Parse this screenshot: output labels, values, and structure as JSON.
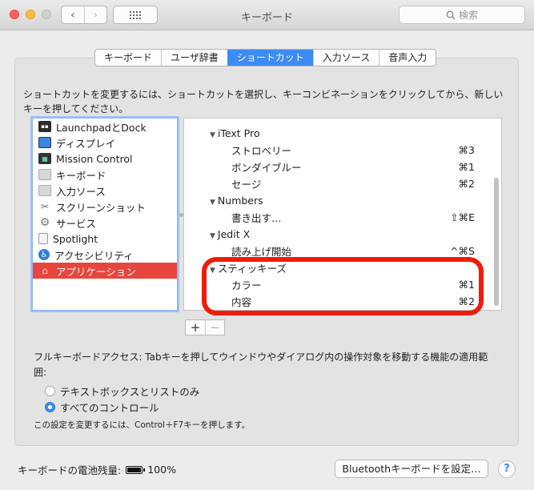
{
  "window": {
    "title": "キーボード",
    "search_placeholder": "検索",
    "back_glyph": "‹",
    "forward_glyph": "›"
  },
  "tabs": [
    {
      "label": "キーボード"
    },
    {
      "label": "ユーザ辞書"
    },
    {
      "label": "ショートカット",
      "active": true
    },
    {
      "label": "入力ソース"
    },
    {
      "label": "音声入力"
    }
  ],
  "description": "ショートカットを変更するには、ショートカットを選択し、キーコンビネーションをクリックしてから、新しいキーを押してください。",
  "categories": [
    {
      "label": "LaunchpadとDock",
      "icon": "launchpad-icon"
    },
    {
      "label": "ディスプレイ",
      "icon": "display-icon"
    },
    {
      "label": "Mission Control",
      "icon": "mission-control-icon"
    },
    {
      "label": "キーボード",
      "icon": "keyboard-icon"
    },
    {
      "label": "入力ソース",
      "icon": "input-source-icon"
    },
    {
      "label": "スクリーンショット",
      "icon": "screenshot-icon"
    },
    {
      "label": "サービス",
      "icon": "gear-icon"
    },
    {
      "label": "Spotlight",
      "icon": "spotlight-icon"
    },
    {
      "label": "アクセシビリティ",
      "icon": "accessibility-icon"
    },
    {
      "label": "アプリケーション",
      "icon": "app-store-icon",
      "selected": true
    }
  ],
  "shortcuts": [
    {
      "label": "iText Pro",
      "key": "",
      "group": true
    },
    {
      "label": "ストロベリー",
      "key": "⌘3"
    },
    {
      "label": "ボンダイブルー",
      "key": "⌘1"
    },
    {
      "label": "セージ",
      "key": "⌘2"
    },
    {
      "label": "Numbers",
      "key": "",
      "group": true
    },
    {
      "label": "書き出す…",
      "key": "⇧⌘E"
    },
    {
      "label": "Jedit X",
      "key": "",
      "group": true
    },
    {
      "label": "読み上げ開始",
      "key": "^⌘S"
    },
    {
      "label": "スティッキーズ",
      "key": "",
      "group": true
    },
    {
      "label": "カラー",
      "key": "⌘1"
    },
    {
      "label": "内容",
      "key": "⌘2"
    }
  ],
  "buttons": {
    "add": "+",
    "remove": "−"
  },
  "full_keyboard_access": {
    "text": "フルキーボードアクセス: Tabキーを押してウインドウやダイアログ内の操作対象を移動する機能の適用範囲:",
    "options": [
      {
        "label": "テキストボックスとリストのみ",
        "selected": false
      },
      {
        "label": "すべてのコントロール",
        "selected": true
      }
    ],
    "note": "この設定を変更するには、Control＋F7キーを押します。"
  },
  "footer": {
    "battery_label": "キーボードの電池残量:",
    "battery_value": "100%",
    "bluetooth_button": "Bluetoothキーボードを設定…",
    "help": "?"
  },
  "colors": {
    "accent": "#3d8cf5",
    "selection": "#e8453c",
    "annotation": "#f01c0a"
  }
}
